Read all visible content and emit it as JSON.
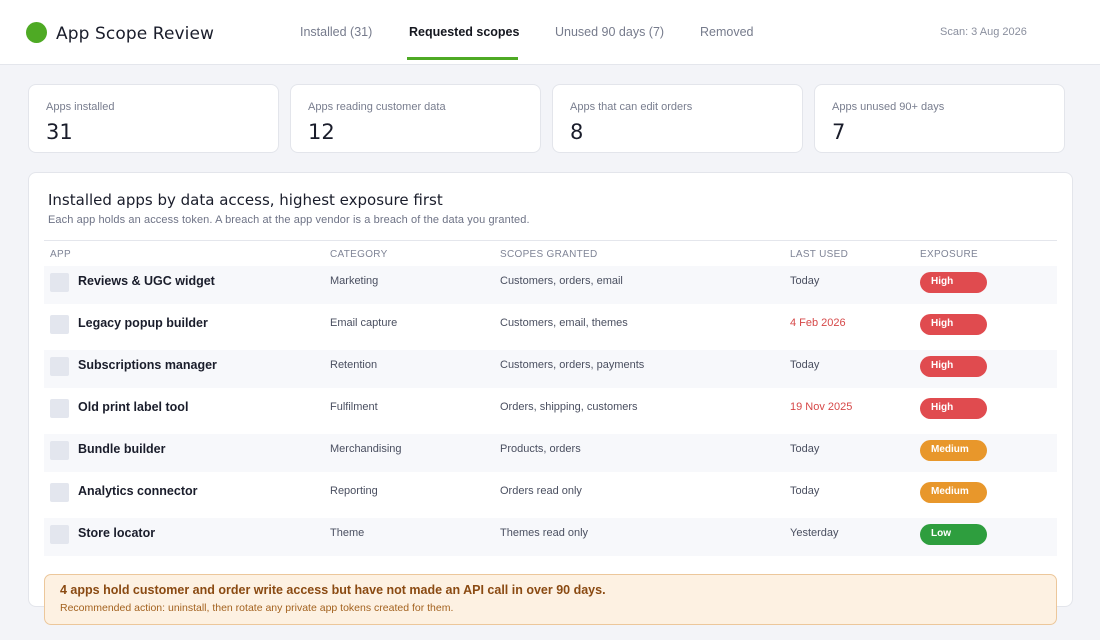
{
  "header": {
    "title": "App Scope Review",
    "tabs": [
      {
        "label": "Installed (31)",
        "active": false
      },
      {
        "label": "Requested scopes",
        "active": true
      },
      {
        "label": "Unused 90 days (7)",
        "active": false
      },
      {
        "label": "Removed",
        "active": false
      }
    ],
    "scan_date": "Scan: 3 Aug 2026",
    "accent_color": "#4eaa24"
  },
  "stats": [
    {
      "label": "Apps installed",
      "value": "31"
    },
    {
      "label": "Apps reading customer data",
      "value": "12"
    },
    {
      "label": "Apps that can edit orders",
      "value": "8"
    },
    {
      "label": "Apps unused 90+ days",
      "value": "7"
    }
  ],
  "table": {
    "title": "Installed apps by data access, highest exposure first",
    "subtitle": "Each app holds an access token. A breach at the app vendor is a breach of the data you granted.",
    "columns": [
      "APP",
      "CATEGORY",
      "SCOPES GRANTED",
      "LAST USED",
      "EXPOSURE"
    ],
    "rows": [
      {
        "app": "Reviews & UGC widget",
        "category": "Marketing",
        "scopes": "Customers, orders, email",
        "last_used": "Today",
        "stale": false,
        "exposure": "High"
      },
      {
        "app": "Legacy popup builder",
        "category": "Email capture",
        "scopes": "Customers, email, themes",
        "last_used": "4 Feb 2026",
        "stale": true,
        "exposure": "High"
      },
      {
        "app": "Subscriptions manager",
        "category": "Retention",
        "scopes": "Customers, orders, payments",
        "last_used": "Today",
        "stale": false,
        "exposure": "High"
      },
      {
        "app": "Old print label tool",
        "category": "Fulfilment",
        "scopes": "Orders, shipping, customers",
        "last_used": "19 Nov 2025",
        "stale": true,
        "exposure": "High"
      },
      {
        "app": "Bundle builder",
        "category": "Merchandising",
        "scopes": "Products, orders",
        "last_used": "Today",
        "stale": false,
        "exposure": "Medium"
      },
      {
        "app": "Analytics connector",
        "category": "Reporting",
        "scopes": "Orders read only",
        "last_used": "Today",
        "stale": false,
        "exposure": "Medium"
      },
      {
        "app": "Store locator",
        "category": "Theme",
        "scopes": "Themes read only",
        "last_used": "Yesterday",
        "stale": false,
        "exposure": "Low"
      }
    ]
  },
  "alert": {
    "title": "4 apps hold customer and order write access but have not made an API call in over 90 days.",
    "body": "Recommended action: uninstall, then rotate any private app tokens created for them."
  }
}
